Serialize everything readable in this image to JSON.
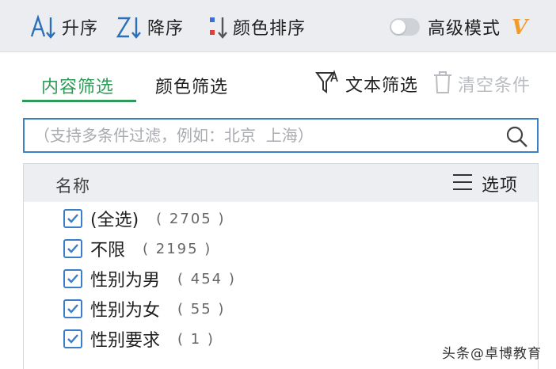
{
  "toolbar": {
    "asc_label": "升序",
    "desc_label": "降序",
    "color_sort_label": "颜色排序",
    "advanced_mode_label": "高级模式",
    "advanced_mode_on": false,
    "vip_badge": "V"
  },
  "tabs": [
    {
      "label": "内容筛选",
      "active": true
    },
    {
      "label": "颜色筛选",
      "active": false
    }
  ],
  "actions": {
    "text_filter_label": "文本筛选",
    "clear_label": "清空条件"
  },
  "search": {
    "placeholder": "（支持多条件过滤，例如：北京  上海）",
    "value": ""
  },
  "list": {
    "header_label": "名称",
    "options_label": "选项",
    "items": [
      {
        "label": "(全选)",
        "count": "( 2705 )",
        "checked": true
      },
      {
        "label": "不限",
        "count": "( 2195 )",
        "checked": true
      },
      {
        "label": "性别为男",
        "count": "( 454 )",
        "checked": true
      },
      {
        "label": "性别为女",
        "count": "( 55 )",
        "checked": true
      },
      {
        "label": "性别要求",
        "count": "( 1 )",
        "checked": true
      }
    ]
  },
  "watermark": "头条@卓博教育",
  "colors": {
    "accent_green": "#2e9a57",
    "accent_blue": "#3b82c4",
    "vip_orange": "#f19b2c",
    "disabled_text": "#b9bcc0"
  },
  "icons": [
    "sort-ascending-icon",
    "sort-descending-icon",
    "color-sort-icon",
    "toggle-switch",
    "vip-icon",
    "text-filter-icon",
    "trash-icon",
    "search-icon",
    "menu-lines-icon",
    "checkbox-checked-icon"
  ]
}
